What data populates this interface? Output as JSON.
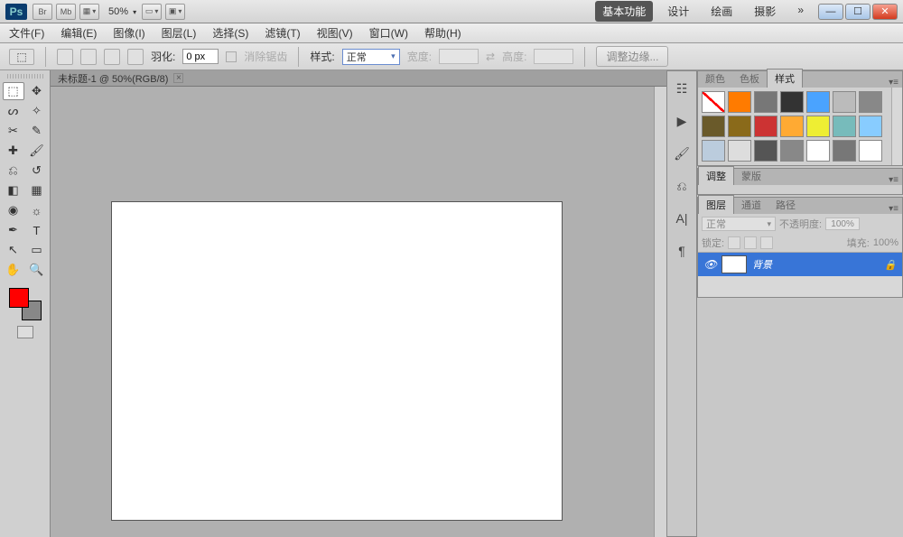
{
  "titlebar": {
    "logo": "Ps",
    "buttons": [
      "Br",
      "Mb"
    ],
    "zoom": "50%",
    "workspaces": {
      "active": "基本功能",
      "items": [
        "基本功能",
        "设计",
        "绘画",
        "摄影"
      ],
      "more": "»"
    }
  },
  "menu": {
    "items": [
      "文件(F)",
      "编辑(E)",
      "图像(I)",
      "图层(L)",
      "选择(S)",
      "滤镜(T)",
      "视图(V)",
      "窗口(W)",
      "帮助(H)"
    ]
  },
  "options": {
    "feather_label": "羽化:",
    "feather_value": "0 px",
    "antialias": "消除锯齿",
    "style_label": "样式:",
    "style_value": "正常",
    "width_label": "宽度:",
    "height_label": "高度:",
    "refine": "调整边缘..."
  },
  "document": {
    "tab_title": "未标题-1 @ 50%(RGB/8)"
  },
  "panels": {
    "color_tabs": [
      "颜色",
      "色板",
      "样式"
    ],
    "adjust_tabs": [
      "调整",
      "蒙版"
    ],
    "layer_tabs": [
      "图层",
      "通道",
      "路径"
    ],
    "blend_mode": "正常",
    "opacity_label": "不透明度:",
    "opacity_value": "100%",
    "lock_label": "锁定:",
    "fill_label": "填充:",
    "fill_value": "100%",
    "layer_name": "背景"
  },
  "styles": [
    "none",
    "#ff7b00",
    "#777",
    "#333",
    "#4aa3ff",
    "#bbb",
    "#888",
    "#6a5a2a",
    "#8a6a1a",
    "#c33",
    "#fa3",
    "#ee3",
    "#7bb",
    "#8cf",
    "#bcd",
    "#ddd",
    "#555",
    "#888",
    "#fff",
    "#777",
    "#fff"
  ]
}
